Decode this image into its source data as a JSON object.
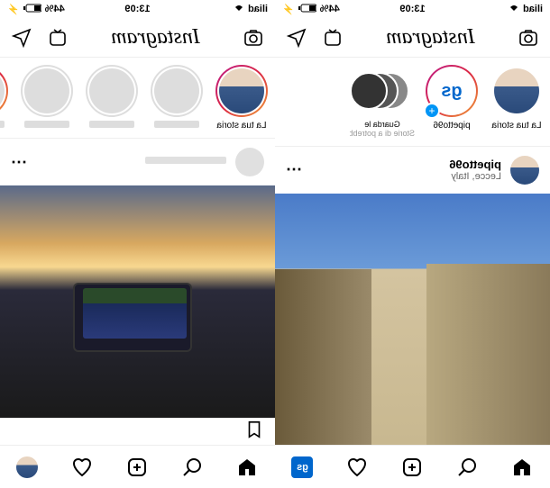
{
  "status": {
    "carrier": "iliad",
    "signal_pct": "44%",
    "time": "13:09",
    "battery_icon": "battery"
  },
  "app": {
    "logo": "Instagram",
    "icons": {
      "dm": "paper-plane",
      "igtv": "igtv",
      "camera": "camera"
    }
  },
  "left": {
    "stories": [
      {
        "label": "La tua storia",
        "type": "self"
      },
      {
        "label": "",
        "type": "placeholder"
      },
      {
        "label": "",
        "type": "placeholder"
      },
      {
        "label": "",
        "type": "placeholder"
      }
    ],
    "post": {
      "username": "",
      "location": ""
    }
  },
  "right": {
    "stories": [
      {
        "label": "La tua storia",
        "type": "self"
      },
      {
        "label": "pipetto96",
        "type": "user"
      },
      {
        "label": "Guarda le",
        "sublabel": "Storie di a potrebbero",
        "type": "suggest"
      }
    ],
    "post": {
      "username": "pipetto96",
      "location": "Lecce, Italy"
    }
  },
  "tabs": {
    "home": "home",
    "search": "search",
    "add": "add",
    "activity": "heart",
    "profile": "profile"
  }
}
